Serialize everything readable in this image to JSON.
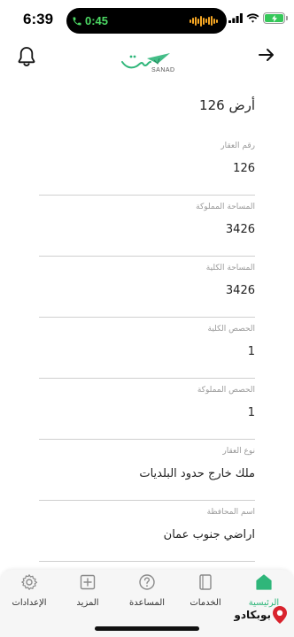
{
  "status_bar": {
    "time": "6:39",
    "call_duration": "0:45"
  },
  "header": {
    "logo_text": "SANAD"
  },
  "detail": {
    "title": "أرض 126",
    "fields": [
      {
        "label": "رقم العقار",
        "value": "126"
      },
      {
        "label": "المساحة المملوكة",
        "value": "3426"
      },
      {
        "label": "المساحة الكلية",
        "value": "3426"
      },
      {
        "label": "الحصص الكلية",
        "value": "1"
      },
      {
        "label": "الحصص المملوكة",
        "value": "1"
      },
      {
        "label": "نوع العقار",
        "value": "ملك خارج حدود البلديات"
      },
      {
        "label": "اسم المحافظة",
        "value": "اراضي جنوب عمان"
      }
    ]
  },
  "tabs": [
    {
      "label": "الرئيسية",
      "icon": "home-icon",
      "active": true
    },
    {
      "label": "الخدمات",
      "icon": "services-icon",
      "active": false
    },
    {
      "label": "المساعدة",
      "icon": "help-icon",
      "active": false
    },
    {
      "label": "المزيد",
      "icon": "more-icon",
      "active": false
    },
    {
      "label": "الإعدادات",
      "icon": "settings-icon",
      "active": false
    }
  ],
  "watermark": {
    "text": "بوبكادو"
  },
  "colors": {
    "accent": "#2fb67a",
    "call_green": "#4cd964",
    "battery_green": "#35c759"
  }
}
